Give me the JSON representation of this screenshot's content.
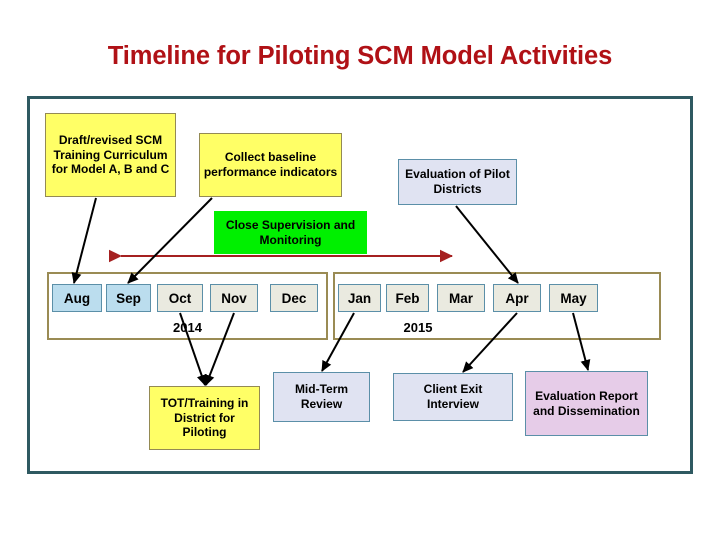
{
  "title": "Timeline for Piloting SCM Model Activities",
  "colors": {
    "title": "#B01116",
    "frame": "#2E5961",
    "yellow_fill": "#FFFF66",
    "yellow_border": "#948A54",
    "green_fill": "#00F000",
    "lavender_fill": "#E0E3F2",
    "pink_fill": "#E6CCE8",
    "box_border_blue": "#5B8FA8",
    "year_frame": "#9A8B54",
    "month_active": "#BBDDEE",
    "month_idle": "#EAEAE0",
    "arrow": "#A52020",
    "connector": "#000000"
  },
  "activities_top": [
    {
      "id": "draft-curriculum",
      "label": "Draft/revised SCM Training Curriculum for Model A, B and C",
      "style": "yellow"
    },
    {
      "id": "collect-baseline",
      "label": "Collect baseline performance indicators",
      "style": "yellow"
    },
    {
      "id": "evaluation-pilot-districts",
      "label": "Evaluation of Pilot Districts",
      "style": "lavender"
    },
    {
      "id": "close-supervision",
      "label": "Close Supervision and Monitoring",
      "style": "green"
    }
  ],
  "activities_bottom": [
    {
      "id": "tot-training",
      "label": "TOT/Training in District for Piloting",
      "style": "yellow"
    },
    {
      "id": "mid-term-review",
      "label": "Mid-Term Review",
      "style": "lavender"
    },
    {
      "id": "client-exit-interview",
      "label": "Client Exit Interview",
      "style": "lavender"
    },
    {
      "id": "evaluation-report",
      "label": "Evaluation Report and Dissemination",
      "style": "pink"
    }
  ],
  "timeline": {
    "years": [
      {
        "id": "year-2014",
        "label": "2014",
        "months": [
          {
            "label": "Aug",
            "state": "active"
          },
          {
            "label": "Sep",
            "state": "active"
          },
          {
            "label": "Oct",
            "state": "idle"
          },
          {
            "label": "Nov",
            "state": "idle"
          },
          {
            "label": "Dec",
            "state": "idle"
          }
        ]
      },
      {
        "id": "year-2015",
        "label": "2015",
        "months": [
          {
            "label": "Jan",
            "state": "idle"
          },
          {
            "label": "Feb",
            "state": "idle"
          },
          {
            "label": "Mar",
            "state": "idle"
          },
          {
            "label": "Apr",
            "state": "idle"
          },
          {
            "label": "May",
            "state": "idle"
          }
        ]
      }
    ]
  },
  "range_arrow": {
    "id": "supervision-span-arrow",
    "description": "double-headed arrow spanning Aug 2014 to Mar 2015"
  }
}
